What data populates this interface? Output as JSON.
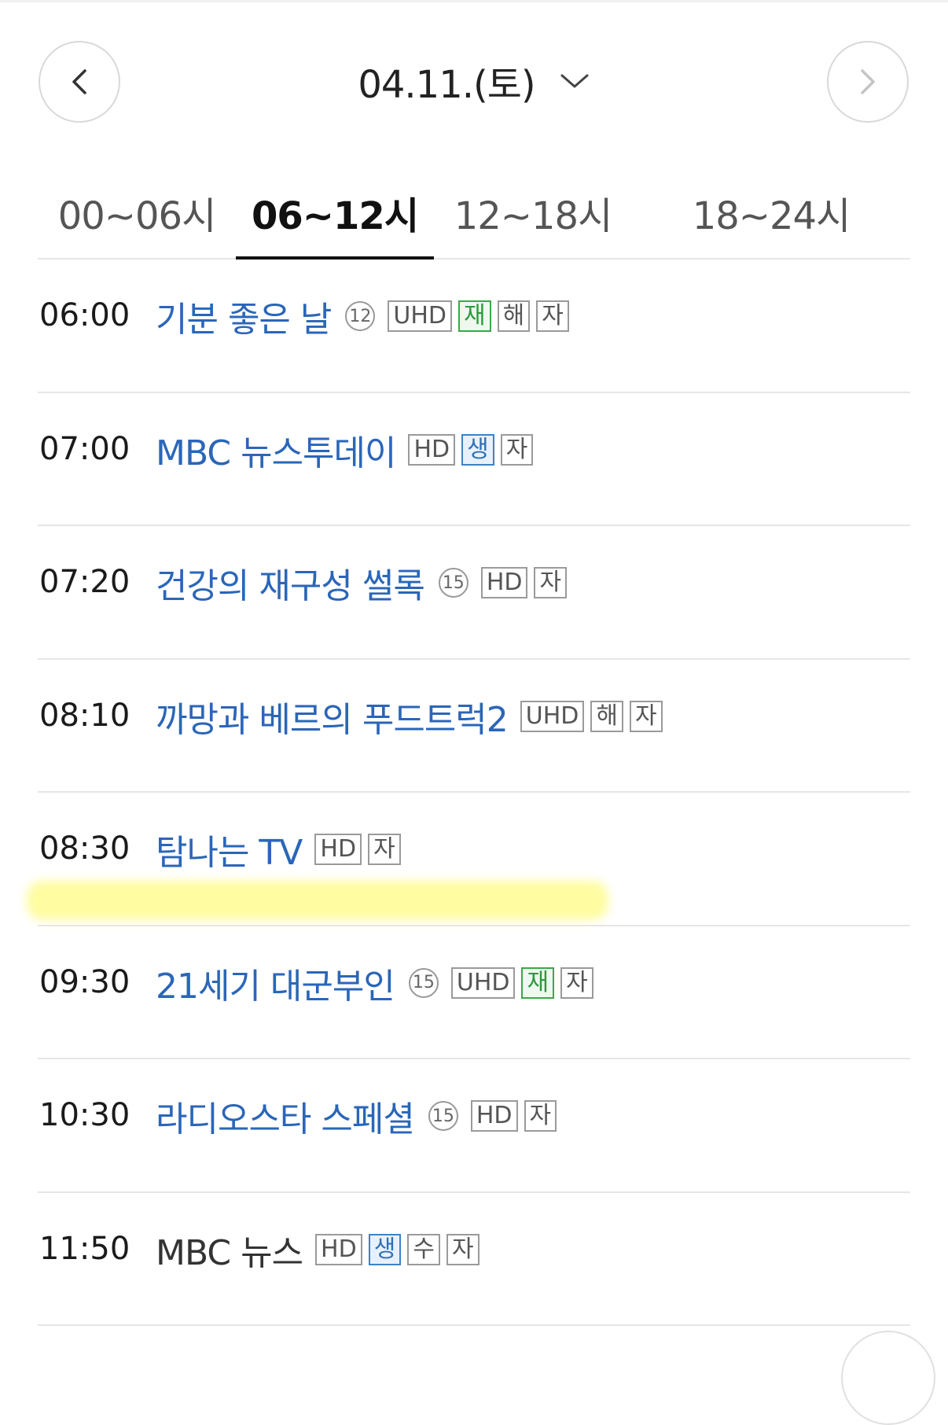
{
  "header": {
    "date": "04.11.(토)",
    "prev_icon": "chevron-left-icon",
    "next_icon": "chevron-right-icon",
    "dropdown_icon": "chevron-down-icon"
  },
  "tabs": [
    {
      "label": "00~06시",
      "active": false
    },
    {
      "label": "06~12시",
      "active": true
    },
    {
      "label": "12~18시",
      "active": false
    },
    {
      "label": "18~24시",
      "active": false
    }
  ],
  "programs": [
    {
      "time": "06:00",
      "title": "기분 좋은 날",
      "age": "12",
      "badges": [
        "UHD",
        "재",
        "해",
        "자"
      ]
    },
    {
      "time": "07:00",
      "title": "MBC 뉴스투데이",
      "age": "",
      "badges": [
        "HD",
        "생",
        "자"
      ]
    },
    {
      "time": "07:20",
      "title": "건강의 재구성 썰록",
      "age": "15",
      "badges": [
        "HD",
        "자"
      ]
    },
    {
      "time": "08:10",
      "title": "까망과 베르의 푸드트럭2",
      "age": "",
      "badges": [
        "UHD",
        "해",
        "자"
      ]
    },
    {
      "time": "08:30",
      "title": "탐나는 TV",
      "age": "",
      "badges": [
        "HD",
        "자"
      ]
    },
    {
      "time": "09:30",
      "title": "21세기 대군부인",
      "age": "15",
      "badges": [
        "UHD",
        "재",
        "자"
      ]
    },
    {
      "time": "10:30",
      "title": "라디오스타 스페셜",
      "age": "15",
      "badges": [
        "HD",
        "자"
      ]
    },
    {
      "time": "11:50",
      "title": "MBC 뉴스",
      "age": "",
      "badges": [
        "HD",
        "생",
        "수",
        "자"
      ]
    }
  ],
  "colors": {
    "title_link": "#2b66b8",
    "title_plain": "#333333",
    "rerun_badge": "#2a9a3a",
    "live_badge": "#2f6fb3",
    "highlight": "#fffa6e"
  }
}
